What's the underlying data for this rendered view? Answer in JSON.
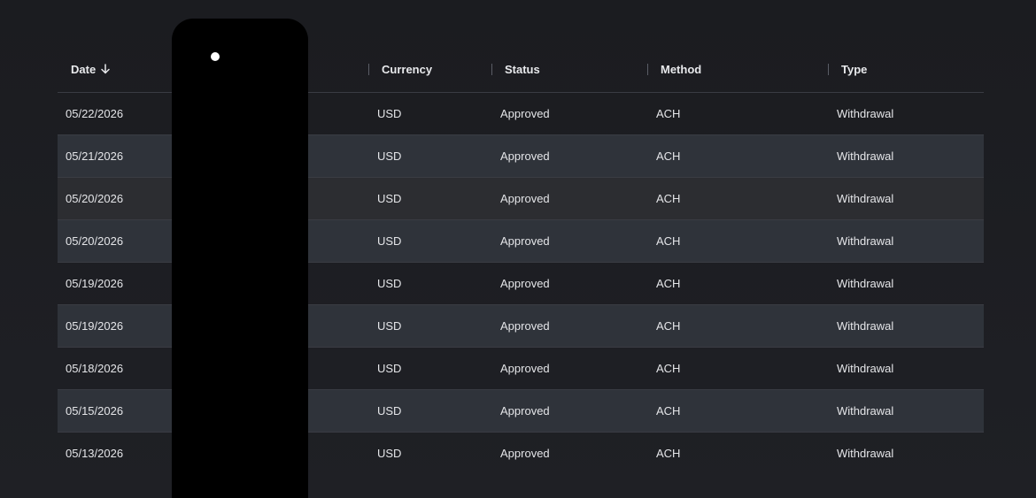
{
  "table": {
    "columns": {
      "date": "Date",
      "currency": "Currency",
      "status": "Status",
      "method": "Method",
      "type": "Type"
    },
    "sort": {
      "column": "date",
      "direction": "descending",
      "icon": "arrow-down-icon"
    },
    "rows": [
      {
        "date": "05/22/2026",
        "currency": "USD",
        "status": "Approved",
        "method": "ACH",
        "type": "Withdrawal"
      },
      {
        "date": "05/21/2026",
        "currency": "USD",
        "status": "Approved",
        "method": "ACH",
        "type": "Withdrawal"
      },
      {
        "date": "05/20/2026",
        "currency": "USD",
        "status": "Approved",
        "method": "ACH",
        "type": "Withdrawal"
      },
      {
        "date": "05/20/2026",
        "currency": "USD",
        "status": "Approved",
        "method": "ACH",
        "type": "Withdrawal"
      },
      {
        "date": "05/19/2026",
        "currency": "USD",
        "status": "Approved",
        "method": "ACH",
        "type": "Withdrawal"
      },
      {
        "date": "05/19/2026",
        "currency": "USD",
        "status": "Approved",
        "method": "ACH",
        "type": "Withdrawal"
      },
      {
        "date": "05/18/2026",
        "currency": "USD",
        "status": "Approved",
        "method": "ACH",
        "type": "Withdrawal"
      },
      {
        "date": "05/15/2026",
        "currency": "USD",
        "status": "Approved",
        "method": "ACH",
        "type": "Withdrawal"
      },
      {
        "date": "05/13/2026",
        "currency": "USD",
        "status": "Approved",
        "method": "ACH",
        "type": "Withdrawal"
      }
    ]
  },
  "colors": {
    "background": "#1e1f24",
    "row_stripe": "#2f333a",
    "row_hover": "#2c2d31",
    "divider": "#3a3c43",
    "text": "#e4e5e8",
    "redaction": "#000000"
  }
}
